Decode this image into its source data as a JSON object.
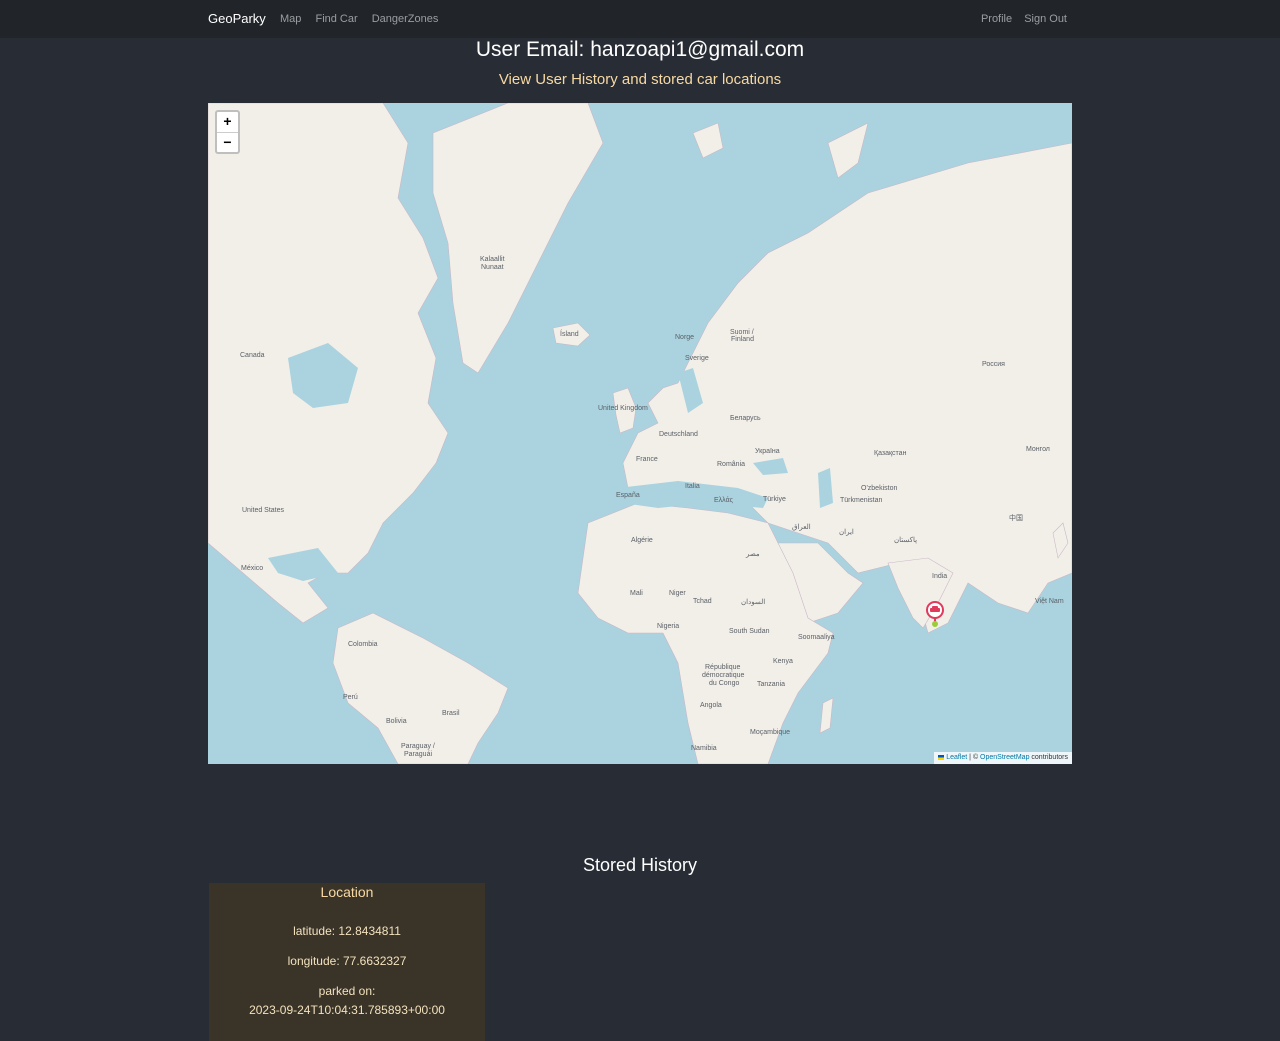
{
  "navbar": {
    "brand": "GeoParky",
    "links": [
      "Map",
      "Find Car",
      "DangerZones"
    ],
    "right_links": [
      "Profile",
      "Sign Out"
    ]
  },
  "header": {
    "email_text": "User Email: hanzoapi1@gmail.com",
    "subtitle": "View User History and stored car locations"
  },
  "map": {
    "zoom_in": "+",
    "zoom_out": "−",
    "attribution": {
      "leaflet": "Leaflet",
      "separator": " | © ",
      "osm": "OpenStreetMap",
      "contributors": " contributors"
    },
    "labels": {
      "kalaallit": "Kalaallit",
      "nunaat": "Nunaat",
      "island": "Ísland",
      "canada": "Canada",
      "norge": "Norge",
      "suomi": "Suomi /",
      "finland": "Finland",
      "sverige": "Sverige",
      "rossiya": "Россия",
      "uk": "United Kingdom",
      "belarus": "Беларусь",
      "deutschland": "Deutschland",
      "ukraina": "Україна",
      "france": "France",
      "romania": "România",
      "kazakhstan": "Қазақстан",
      "mongol": "Монгол",
      "us": "United States",
      "espana": "España",
      "italia": "Italia",
      "ellada": "Ελλάς",
      "turkiye": "Türkiye",
      "ozbekiston": "O'zbekiston",
      "turkmenistan": "Türkmenistan",
      "china": "中国",
      "mexico": "México",
      "algerie": "Algérie",
      "misr": "مصر",
      "iraq": "العراق",
      "iran": "ایران",
      "pakistan": "پاکستان",
      "india": "India",
      "mali": "Mali",
      "niger": "Niger",
      "tchad": "Tchad",
      "sudan": "السودان",
      "vietnam": "Việt Nam",
      "nigeria": "Nigeria",
      "south_sudan": "South Sudan",
      "colombia": "Colombia",
      "somalia": "Soomaaliya",
      "kenya": "Kenya",
      "rdc1": "République",
      "rdc2": "démocratique",
      "rdc3": "du Congo",
      "tanzania": "Tanzania",
      "peru": "Perú",
      "brasil": "Brasil",
      "bolivia": "Bolivia",
      "angola": "Angola",
      "mocambique": "Moçambique",
      "paraguay": "Paraguay /",
      "paragua": "Paraguái",
      "namibia": "Namibia"
    },
    "marker_color": "#e03a5c",
    "water_color": "#aad3df",
    "land_color": "#f2efe9"
  },
  "history": {
    "title": "Stored History",
    "card": {
      "title": "Location",
      "latitude": "latitude: 12.8434811",
      "longitude": "longitude: 77.6632327",
      "parked_label": "parked on:",
      "parked_value": "2023-09-24T10:04:31.785893+00:00"
    }
  }
}
